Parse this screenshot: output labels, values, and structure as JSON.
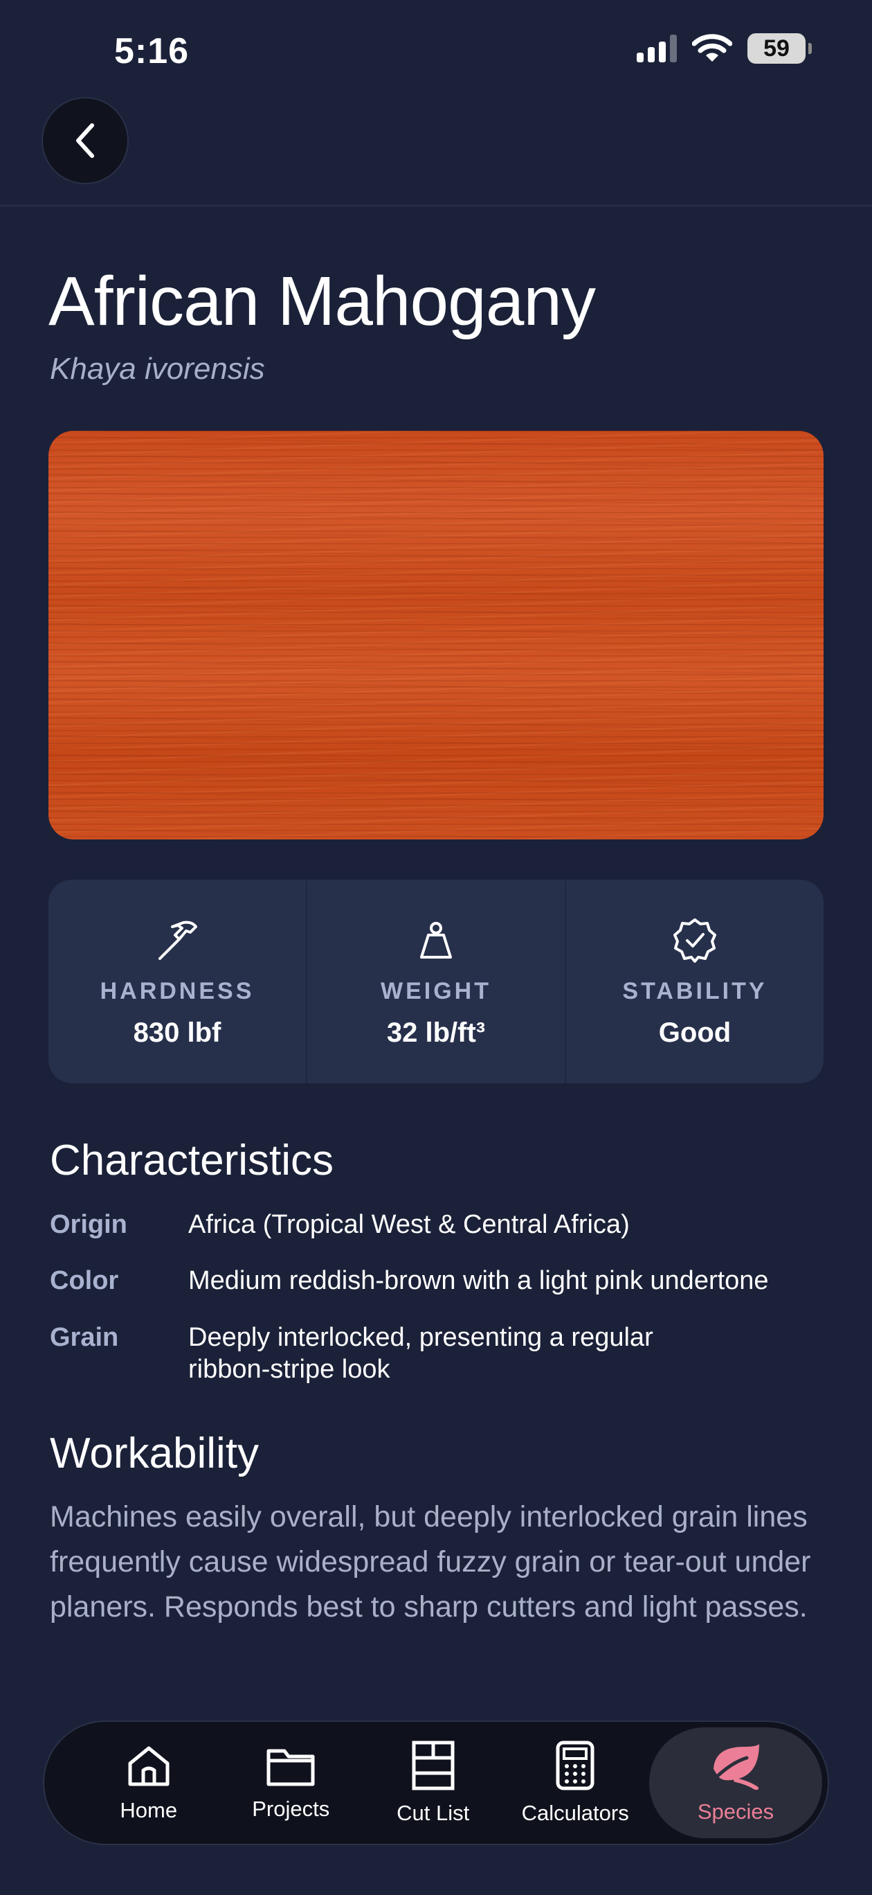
{
  "status_bar": {
    "time": "5:16",
    "battery": "59"
  },
  "species": {
    "name": "African Mahogany",
    "scientific_name": "Khaya ivorensis",
    "texture_colors": {
      "base": "#cc4f20",
      "dark_grain": "#7a1e00"
    }
  },
  "stats": [
    {
      "icon": "hammer-icon",
      "label": "HARDNESS",
      "value": "830 lbf"
    },
    {
      "icon": "weight-icon",
      "label": "WEIGHT",
      "value": "32 lb/ft³"
    },
    {
      "icon": "verified-badge-icon",
      "label": "STABILITY",
      "value": "Good"
    }
  ],
  "characteristics": {
    "heading": "Characteristics",
    "rows": [
      {
        "key": "Origin",
        "value": "Africa (Tropical West & Central Africa)"
      },
      {
        "key": "Color",
        "value": "Medium reddish-brown with a light pink undertone"
      },
      {
        "key": "Grain",
        "value": "Deeply interlocked, presenting a regular ribbon-stripe look"
      }
    ]
  },
  "workability": {
    "heading": "Workability",
    "text": "Machines easily overall, but deeply interlocked grain lines frequently cause widespread fuzzy grain or tear-out under planers. Responds best to sharp cutters and light passes."
  },
  "tabs": [
    {
      "icon": "home-icon",
      "label": "Home"
    },
    {
      "icon": "folder-icon",
      "label": "Projects"
    },
    {
      "icon": "cut-list-icon",
      "label": "Cut List"
    },
    {
      "icon": "calculator-icon",
      "label": "Calculators"
    },
    {
      "icon": "leaf-icon",
      "label": "Species",
      "active": true
    }
  ],
  "colors": {
    "background": "#1b2138",
    "card": "#27304b",
    "accent": "#ec7f97",
    "muted": "#a9b3d0"
  }
}
